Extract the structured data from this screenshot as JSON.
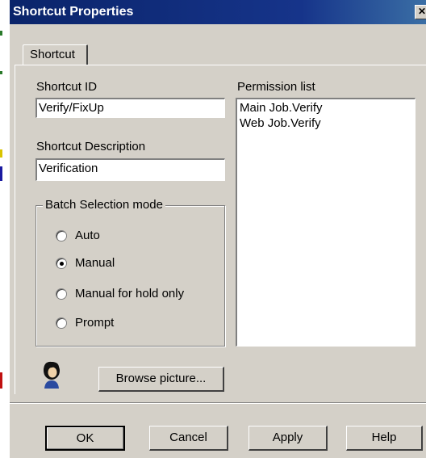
{
  "window": {
    "title": "Shortcut Properties",
    "close_glyph": "✕"
  },
  "tabs": [
    {
      "label": "Shortcut"
    }
  ],
  "shortcut_id": {
    "label": "Shortcut ID",
    "value": "Verify/FixUp"
  },
  "shortcut_description": {
    "label": "Shortcut Description",
    "value": "Verification"
  },
  "batch_selection": {
    "legend": "Batch Selection mode",
    "options": [
      {
        "label": "Auto",
        "selected": false
      },
      {
        "label": "Manual",
        "selected": true
      },
      {
        "label": "Manual for hold only",
        "selected": false
      },
      {
        "label": "Prompt",
        "selected": false
      }
    ]
  },
  "permission_list": {
    "label": "Permission list",
    "items": [
      "Main Job.Verify",
      "Web Job.Verify"
    ]
  },
  "picture": {
    "icon": "user-silhouette-icon",
    "browse_label": "Browse picture..."
  },
  "buttons": {
    "ok": "OK",
    "cancel": "Cancel",
    "apply": "Apply",
    "help": "Help"
  },
  "colors": {
    "titlebar": "#0a246a",
    "face": "#d4d0c8"
  }
}
